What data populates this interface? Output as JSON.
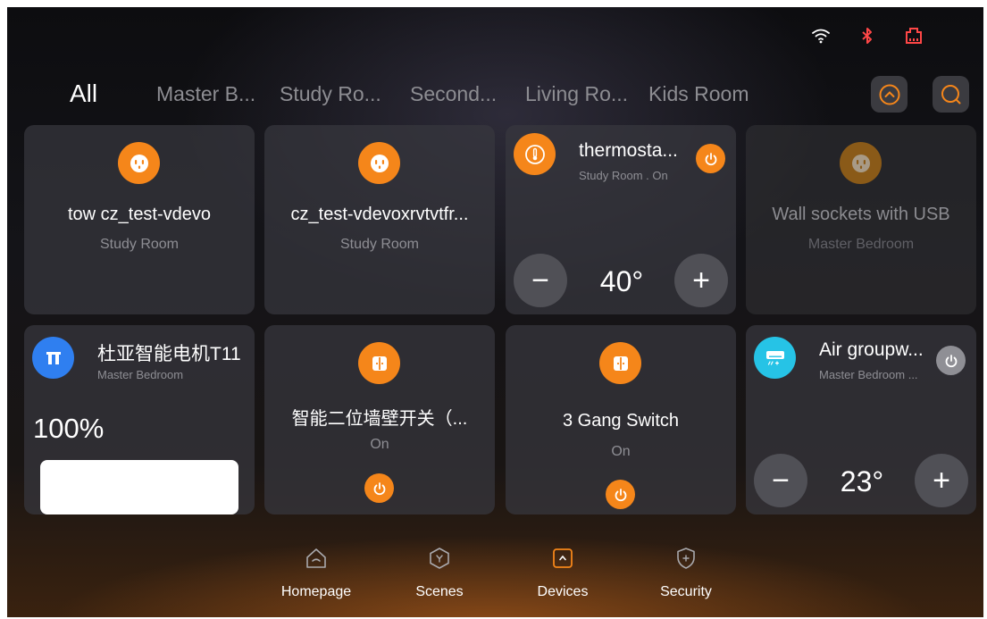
{
  "status": {
    "icons": [
      "wifi-icon",
      "bluetooth-icon",
      "ethernet-icon"
    ],
    "bluetooth_color": "#ff4747",
    "ethernet_color": "#ff4747"
  },
  "tabs": [
    {
      "label": "All",
      "active": true
    },
    {
      "label": "Master B..."
    },
    {
      "label": "Study Ro..."
    },
    {
      "label": "Second..."
    },
    {
      "label": "Living Ro..."
    },
    {
      "label": "Kids Room"
    }
  ],
  "toolbar": {
    "collapse_icon": "chevron-up-circle-icon",
    "search_icon": "search-icon",
    "accent": "#f5861a"
  },
  "cards": [
    {
      "title": "tow cz_test-vdevo",
      "room": "Study Room",
      "icon": "socket-icon"
    },
    {
      "title": "cz_test-vdevoxrvtvtfr...",
      "room": "Study Room",
      "icon": "socket-icon"
    },
    {
      "title": "thermosta...",
      "subtitle": "Study Room . On",
      "icon": "thermometer-icon",
      "value": "40°",
      "minus": "−",
      "plus": "+"
    },
    {
      "title": "Wall sockets with USB",
      "room": "Master Bedroom",
      "icon": "socket-icon",
      "offline": true
    },
    {
      "title": "杜亚智能电机T11",
      "room": "Master Bedroom",
      "icon": "curtain-motor-icon",
      "value": "100%",
      "level": 1.0
    },
    {
      "title": "智能二位墙壁开关（...",
      "state": "On",
      "icon": "switch-icon"
    },
    {
      "title": "3 Gang Switch",
      "state": "On",
      "icon": "switch-icon"
    },
    {
      "title": "Air groupw...",
      "subtitle": "Master Bedroom ...",
      "icon": "air-conditioner-icon",
      "value": "23°",
      "minus": "−",
      "plus": "+",
      "icon_color": "#26c3e6"
    }
  ],
  "nav": [
    {
      "label": "Homepage",
      "icon": "home-icon"
    },
    {
      "label": "Scenes",
      "icon": "scenes-icon"
    },
    {
      "label": "Devices",
      "icon": "devices-icon",
      "active": true
    },
    {
      "label": "Security",
      "icon": "security-shield-icon"
    }
  ]
}
